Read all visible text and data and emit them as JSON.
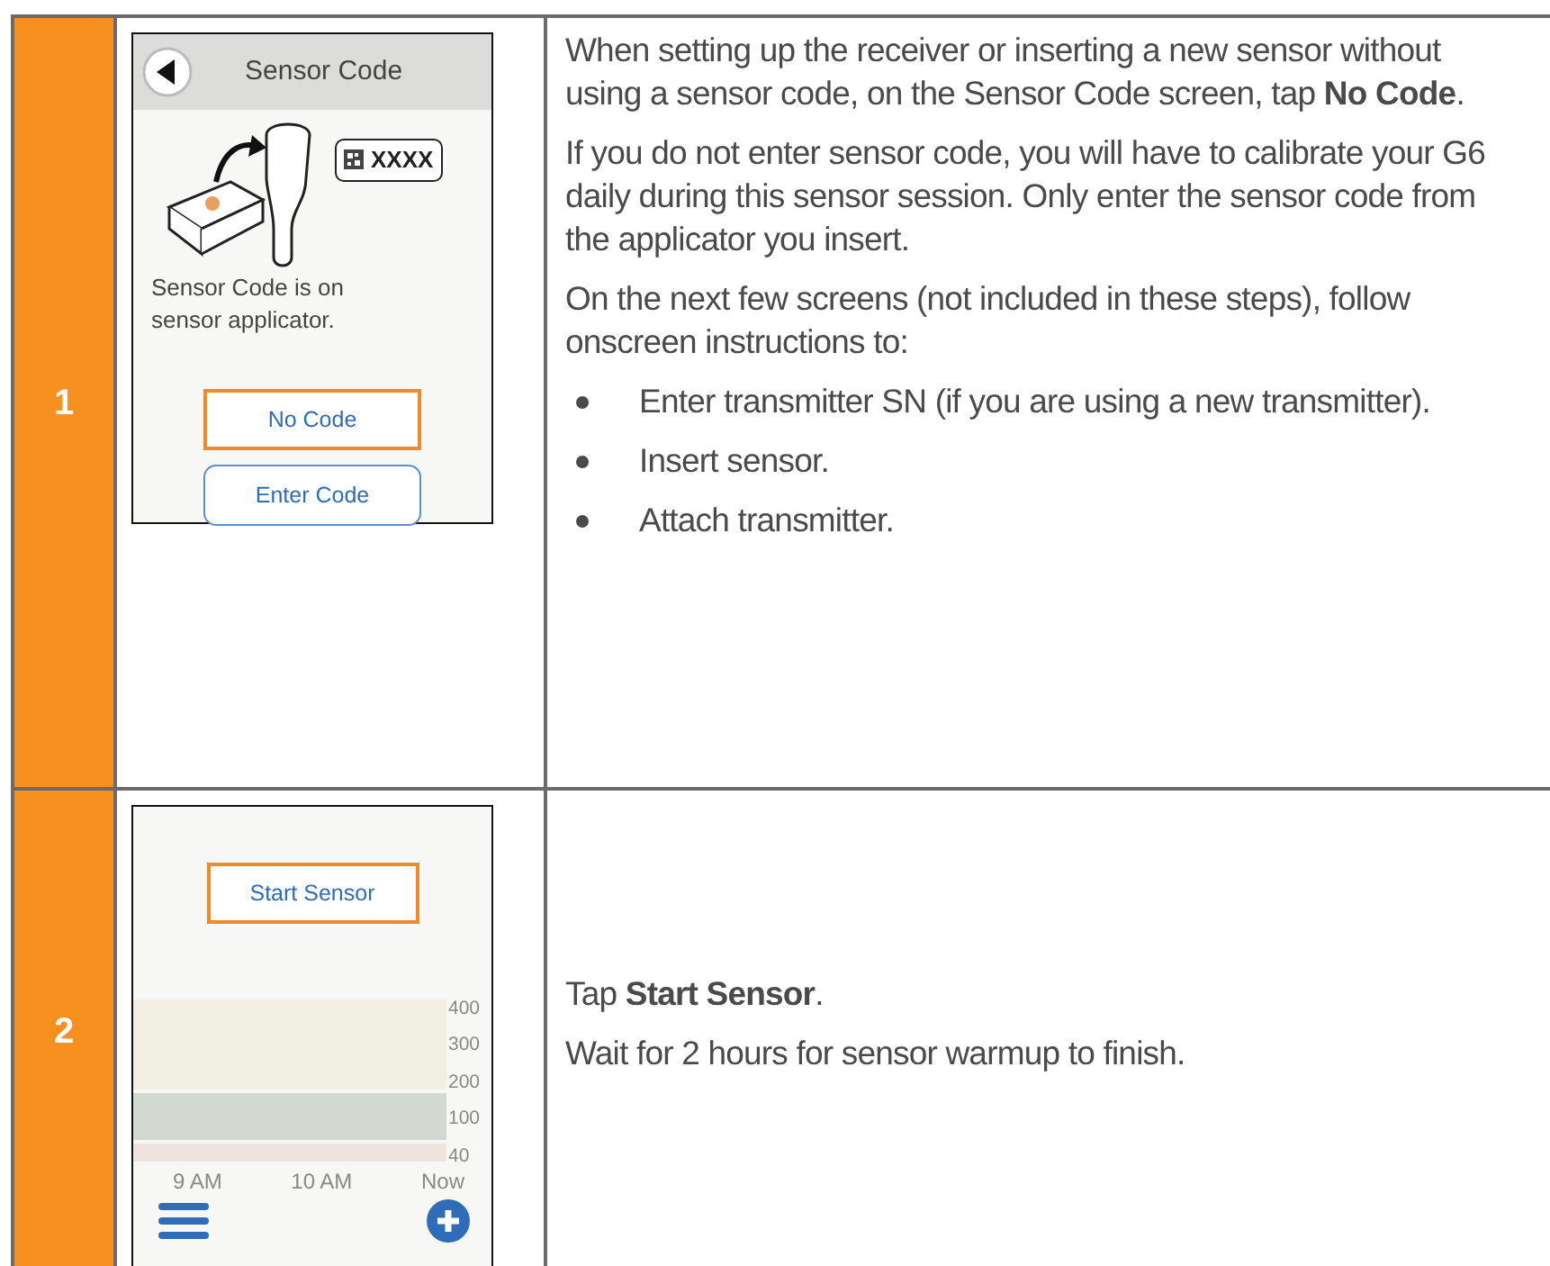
{
  "steps": [
    {
      "number": "1",
      "screen": {
        "kind": "sensor_code",
        "title": "Sensor Code",
        "code_label": "XXXX",
        "message": "Sensor Code is on sensor applicator.",
        "buttons": [
          {
            "label": "No Code",
            "highlighted": true
          },
          {
            "label": "Enter Code",
            "highlighted": false
          }
        ]
      },
      "paragraphs": [
        "When setting up the receiver or inserting a new sensor without using a sensor code, on the Sensor Code screen, tap **No Code**.",
        "If you do not enter sensor code, you will have to calibrate your G6 daily during this sensor session. Only enter the sensor code from the applicator you insert.",
        "On the next few screens (not included in these steps), follow onscreen instructions to:"
      ],
      "bullets": [
        "Enter transmitter SN (if you are using a new transmitter).",
        "Insert sensor.",
        "Attach transmitter."
      ]
    },
    {
      "number": "2",
      "screen": {
        "kind": "start_sensor",
        "buttons": [
          {
            "label": "Start Sensor",
            "highlighted": true
          }
        ],
        "y_labels": [
          "400",
          "300",
          "200",
          "100",
          "40"
        ],
        "x_labels": [
          "9 AM",
          "10 AM",
          "Now"
        ]
      },
      "paragraphs": [
        "Tap **Start Sensor**.",
        "Wait for 2 hours for sensor warmup to finish."
      ]
    }
  ]
}
